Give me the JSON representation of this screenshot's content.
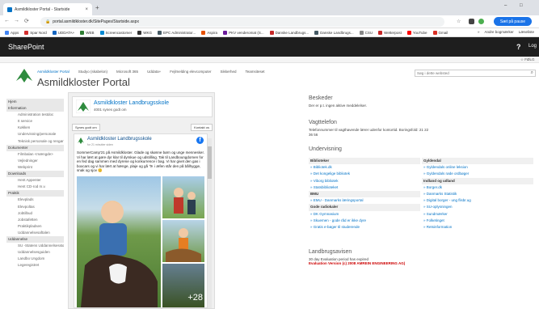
{
  "browser": {
    "tab_title": "Asmildkloster Portal - Startside",
    "new_tab": "+",
    "url": "portal.asmildkloster.dk/SitePages/Startside.aspx",
    "profile_label": "Sæt på pause",
    "window_controls": [
      "–",
      "□"
    ],
    "bookmarks": [
      {
        "label": "Apps",
        "color": "#4285f4"
      },
      {
        "label": "Spar Nord",
        "color": "#d32f2f"
      },
      {
        "label": "UDDATA+",
        "color": "#1565c0"
      },
      {
        "label": "WEB",
        "color": "#2e7d32"
      },
      {
        "label": "Screencastomer",
        "color": "#0288d1"
      },
      {
        "label": "WKG",
        "color": "#333333"
      },
      {
        "label": "EPC Administrator...",
        "color": "#455a64"
      },
      {
        "label": "Aspira",
        "color": "#e65100"
      },
      {
        "label": "PKV venderomat (S...",
        "color": "#6a1b9a"
      },
      {
        "label": "Danske Landbrugs...",
        "color": "#c62828"
      },
      {
        "label": "Danske Landbrugs...",
        "color": "#455a64"
      },
      {
        "label": "CSU",
        "color": "#888888"
      },
      {
        "label": "Wetterpost",
        "color": "#c62828"
      },
      {
        "label": "YouTube",
        "color": "#ff0000"
      },
      {
        "label": "Gmail",
        "color": "#d93025"
      }
    ],
    "bookmarks_right": [
      "»",
      "Andre bogmærker",
      "Læseliste"
    ]
  },
  "suite": {
    "brand": "SharePoint",
    "help": "?",
    "login": "Log"
  },
  "ribbon": {
    "follow": "☆ FØLG"
  },
  "site": {
    "title": "Asmildkloster Portal",
    "search_placeholder": "Søg i dette websted",
    "nav": [
      {
        "label": "Asmildkloster Portal",
        "selected": true
      },
      {
        "label": "Studyo (skabelon)",
        "selected": false
      },
      {
        "label": "Microsoft 365",
        "selected": false
      },
      {
        "label": "Uddata+",
        "selected": false
      },
      {
        "label": "Fejlmelding elevcomputer",
        "selected": false
      },
      {
        "label": "Sikkerhed",
        "selected": false
      },
      {
        "label": "Teamsiteset",
        "selected": false
      }
    ]
  },
  "leftnav": [
    {
      "type": "h",
      "label": "Hjem"
    },
    {
      "type": "h",
      "label": "Information"
    },
    {
      "type": "i",
      "label": "Administration testdoc"
    },
    {
      "type": "i",
      "label": "It service"
    },
    {
      "type": "i",
      "label": "Køkken"
    },
    {
      "type": "i",
      "label": "Undervisning/personale"
    },
    {
      "type": "i",
      "label": "Teknisk personale og rengøringsservice"
    },
    {
      "type": "h",
      "label": "Dokumenter"
    },
    {
      "type": "i",
      "label": "Filmbalan <mængde>"
    },
    {
      "type": "i",
      "label": "Vejledninger"
    },
    {
      "type": "i",
      "label": "Webprint"
    },
    {
      "type": "h",
      "label": "Downloads"
    },
    {
      "type": "i",
      "label": "Hent Appenter"
    },
    {
      "type": "i",
      "label": "Hent CD-rod m.v."
    },
    {
      "type": "h",
      "label": "Praktik"
    },
    {
      "type": "i",
      "label": "Elevplads"
    },
    {
      "type": "i",
      "label": "Elevpoltas"
    },
    {
      "type": "i",
      "label": "Jobtilbud"
    },
    {
      "type": "i",
      "label": "Jobstafetten"
    },
    {
      "type": "i",
      "label": "Praktikpladsen"
    },
    {
      "type": "i",
      "label": "Uddannelsesaftalen"
    },
    {
      "type": "h",
      "label": "Uddannelse"
    },
    {
      "type": "i",
      "label": "SU -Statens Uddannelsesstøtte"
    },
    {
      "type": "i",
      "label": "Uddannelsesguiden"
    },
    {
      "type": "i",
      "label": "Landbo Ungdom"
    },
    {
      "type": "i",
      "label": "Legeregistret"
    }
  ],
  "school": {
    "name": "Asmildkloster Landbrugsskole",
    "subtitle": "4001 synes godt om"
  },
  "fbbar": {
    "share": "Synes godt om",
    "share2": "Kontakt os"
  },
  "post": {
    "page_name": "Asmildkloster Landbrugsskole",
    "time": "for 21 minutter siden",
    "fb_icon": "f",
    "text": "SommerCamp'21 på Asmildkloster. Glade og skønne børn og unge mennesker. Vi har lært at gøre dyr klar til dyrskue og udstilling. Tak til Landboungdomen for en fed dag sammen med dyrene og konkurrence i bag. Vi har givet den gas i boxcars og vi har lært at hænge, plaje og gå 🐄 i æfen står den på bålhygge, snak og sjov 😊",
    "more_photos": "+28"
  },
  "right": {
    "besked_title": "Beskeder",
    "besked_text": "Der er p.t. ingen aktive meddelelser.",
    "vagt_title": "Vagttelefon",
    "vagt_text": "Telefonnummer til vagthavende lærer udenfor kontortid. Boringsfold: 21 22 36 56",
    "undervis_title": "Undervisning",
    "left_list": [
      {
        "type": "hd",
        "label": "Biblioteker"
      },
      {
        "type": "l",
        "label": "» Bibliotek.dk"
      },
      {
        "type": "l",
        "label": "» Det kongelige bibliotek"
      },
      {
        "type": "l",
        "label": "» Viborg bibliotek"
      },
      {
        "type": "l",
        "label": "» Statsbiblioteket"
      },
      {
        "type": "hd",
        "label": "BMU"
      },
      {
        "type": "l",
        "label": "» EMU - Danmarks læringsportal"
      },
      {
        "type": "hd",
        "label": "Gode radiokaler"
      },
      {
        "type": "l",
        "label": "» DK Gymnasium"
      },
      {
        "type": "l",
        "label": "» Skuemen - gode råd er ikke dyre"
      },
      {
        "type": "l",
        "label": "» Gratis e-bøger til studerende"
      }
    ],
    "right_list": [
      {
        "type": "hd",
        "label": "Gyldendal"
      },
      {
        "type": "l",
        "label": "» Gyldendals online leksion"
      },
      {
        "type": "l",
        "label": "» Gyldendals røde ordbøger"
      },
      {
        "type": "hd",
        "label": "Indland og udland"
      },
      {
        "type": "l",
        "label": "» Borger.dk"
      },
      {
        "type": "l",
        "label": "» Danmarks Statistik"
      },
      {
        "type": "l",
        "label": "» Digital borger - ung flisbr.ug"
      },
      {
        "type": "l",
        "label": "» SU-oplysningen"
      },
      {
        "type": "l",
        "label": "» Sundmærker"
      },
      {
        "type": "l",
        "label": "» Folketinget"
      },
      {
        "type": "l",
        "label": "» Retsinformation"
      }
    ],
    "landbrug_title": "Landbrugsavisen",
    "landbrug_text": "30 day Evaluation period has expired",
    "eval_text": "Evaluation Version (c) 2008 AMREIN ENGINEERING AG)"
  },
  "colors": {
    "accent": "#0072c6",
    "suite": "#1e1e1e",
    "logo_green": "#2e8b3e"
  }
}
